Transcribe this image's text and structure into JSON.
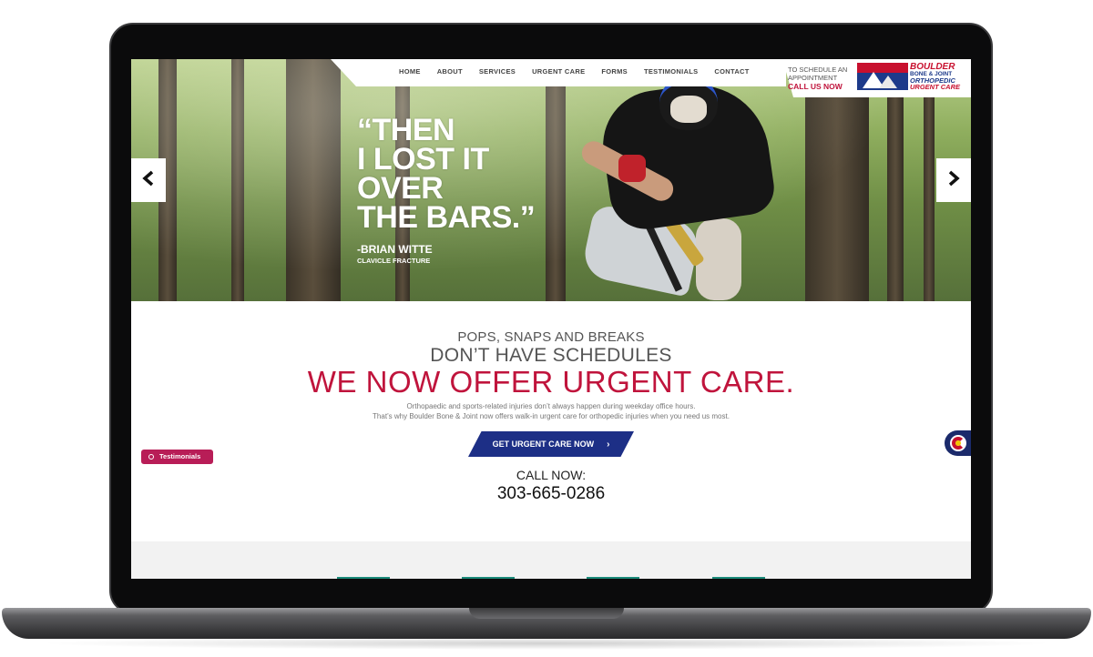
{
  "nav": {
    "items": [
      "HOME",
      "ABOUT",
      "SERVICES",
      "URGENT CARE",
      "FORMS",
      "TESTIMONIALS",
      "CONTACT"
    ]
  },
  "appointment": {
    "line1": "TO SCHEDULE AN",
    "line2": "APPOINTMENT",
    "cta": "CALL US NOW"
  },
  "logo": {
    "line1": "BOULDER",
    "line2": "BONE & JOINT",
    "line3": "ORTHOPEDIC",
    "line4": "URGENT CARE"
  },
  "hero": {
    "quote_lines": [
      "“THEN",
      "I LOST IT",
      "OVER",
      "THE BARS.”"
    ],
    "author": "-BRIAN WITTE",
    "detail": "CLAVICLE FRACTURE",
    "prev_icon": "chevron-left-icon",
    "next_icon": "chevron-right-icon"
  },
  "main": {
    "line1": "POPS, SNAPS AND BREAKS",
    "line2": "DON’T HAVE SCHEDULES",
    "line3": "WE NOW OFFER URGENT CARE.",
    "para1": "Orthopaedic and sports-related injuries don’t always happen during weekday office hours.",
    "para2": "That’s why Boulder Bone & Joint now offers walk-in urgent care for orthopedic injuries when you need us most.",
    "cta_label": "GET URGENT CARE NOW",
    "cta_chevron": "›",
    "call_label": "CALL NOW:",
    "phone": "303-665-0286"
  },
  "side": {
    "testimonials_tab": "Testimonials"
  },
  "colors": {
    "brand_red": "#c0143c",
    "brand_blue": "#1d2f86",
    "tab_pink": "#b81d57"
  }
}
